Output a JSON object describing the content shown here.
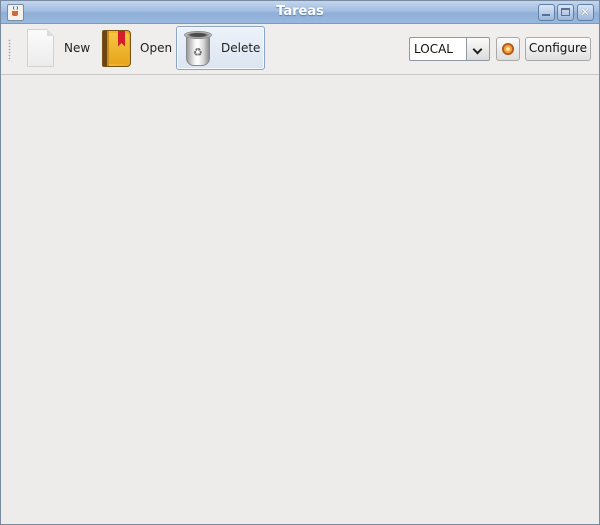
{
  "window": {
    "title": "Tareas"
  },
  "toolbar": {
    "new_label": "New",
    "open_label": "Open",
    "delete_label": "Delete",
    "location_select": {
      "selected": "LOCAL"
    },
    "configure_label": "Configure"
  },
  "colors": {
    "titlebar": "#9ab8de",
    "accent_border": "#8aa3c8",
    "background": "#edeceb"
  }
}
